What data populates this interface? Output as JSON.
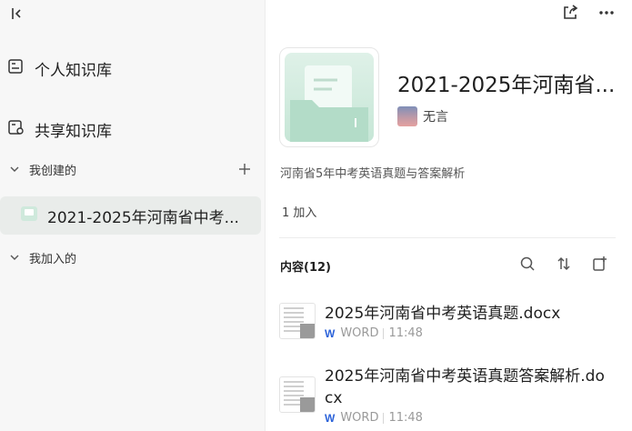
{
  "sidebar": {
    "personal_kb": "个人知识库",
    "shared_kb": "共享知识库",
    "created_by_me": "我创建的",
    "joined": "我加入的",
    "kb_item": "2021-2025年河南省中考..."
  },
  "header": {
    "icons": [
      "share-icon",
      "more-icon"
    ]
  },
  "kb": {
    "title": "2021-2025年河南省...",
    "owner": "无言",
    "description": "河南省5年中考英语真题与答案解析",
    "members": "1 加入"
  },
  "content": {
    "heading": "内容(12)",
    "files": [
      {
        "name": "2025年河南省中考英语真题.docx",
        "type": "WORD",
        "time": "11:48"
      },
      {
        "name": "2025年河南省中考英语真题答案解析.docx",
        "type": "WORD",
        "time": "11:48"
      }
    ]
  },
  "colors": {
    "sidebar_bg": "#f7f7f7",
    "selected_bg": "#e9ecea",
    "cover_green": "#c6e6d6",
    "word_blue": "#2b62d9"
  }
}
